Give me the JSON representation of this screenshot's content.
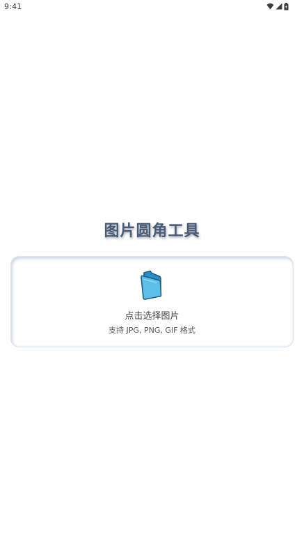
{
  "status_bar": {
    "time": "9:41",
    "icons": [
      "wifi-icon",
      "cellular-icon",
      "battery-icon"
    ]
  },
  "app": {
    "title": "图片圆角工具"
  },
  "upload": {
    "icon": "folder-icon",
    "main_text": "点击选择图片",
    "sub_text": "支持 JPG, PNG, GIF 格式"
  },
  "colors": {
    "title": "#4a5b76",
    "folder_fill": "#5bbfe8",
    "folder_stroke": "#1f5c8a"
  }
}
